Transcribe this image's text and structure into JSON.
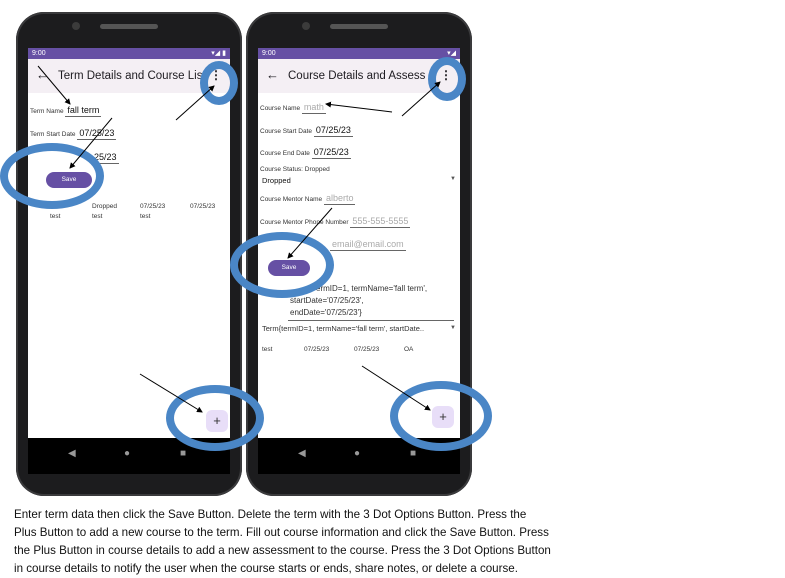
{
  "phone1": {
    "status_time": "9:00",
    "status_icons": "▾◢ ▮",
    "appbar": {
      "back_icon": "arrow-back-icon",
      "title": "Term Details and Course Lis",
      "menu_icon": "more-vert-icon"
    },
    "term_name_label": "Term Name",
    "term_name_value": "fall term",
    "start_label": "Term Start Date",
    "start_value": "07/25/23",
    "end_value_partial": "25/23",
    "save_label": "Save",
    "course_rows": [
      {
        "name": "test",
        "status": "Dropped",
        "start": "07/25/23",
        "end": "07/25/23"
      }
    ],
    "course_row_line2_status": "test",
    "course_row_line2_start": "test",
    "fab_label": "+"
  },
  "phone2": {
    "status_time": "9:00",
    "status_icons": "▾◢",
    "appbar": {
      "back_icon": "arrow-back-icon",
      "title": "Course Details and Assess",
      "menu_icon": "more-vert-icon"
    },
    "course_name_label": "Course Name",
    "course_name_hint": "math",
    "start_label": "Course Start Date",
    "start_value": "07/25/23",
    "end_label": "Course End Date",
    "end_value": "07/25/23",
    "status_label": "Course Status: Dropped",
    "status_value": "Dropped",
    "mentor_name_label": "Course Mentor Name",
    "mentor_name_hint": "alberto",
    "mentor_phone_label": "Course Mentor Phone Number",
    "mentor_phone_hint": "555-555-5555",
    "mentor_email_hint": "email@email.com",
    "save_label": "Save",
    "term_text_line1": "ermID=1, termName='fall term',",
    "term_text_line2": "startDate='07/25/23',",
    "term_text_line3": "endDate='07/25/23'}",
    "term_dropdown": "Term{termID=1, termName='fall term', startDate..",
    "assessment_row": {
      "name": "test",
      "start": "07/25/23",
      "end": "07/25/23",
      "type": "OA"
    },
    "fab_label": "+"
  },
  "nav_icons": {
    "back": "◀",
    "home": "●",
    "recents": "■"
  },
  "instructions": [
    "Enter term data then click the Save Button. Delete the term with the 3 Dot Options Button. Press the",
    "Plus Button to add a new course to the term. Fill out course information and click the Save Button. Press",
    "the Plus Button in course details to add a new assessment to the course. Press the 3 Dot Options Button",
    "in course details to notify the user when the course starts or ends, share notes, or delete a course."
  ],
  "colors": {
    "primary": "#6650a4",
    "highlight_ring": "#4a86c6",
    "fab_bg": "#e8def8"
  }
}
